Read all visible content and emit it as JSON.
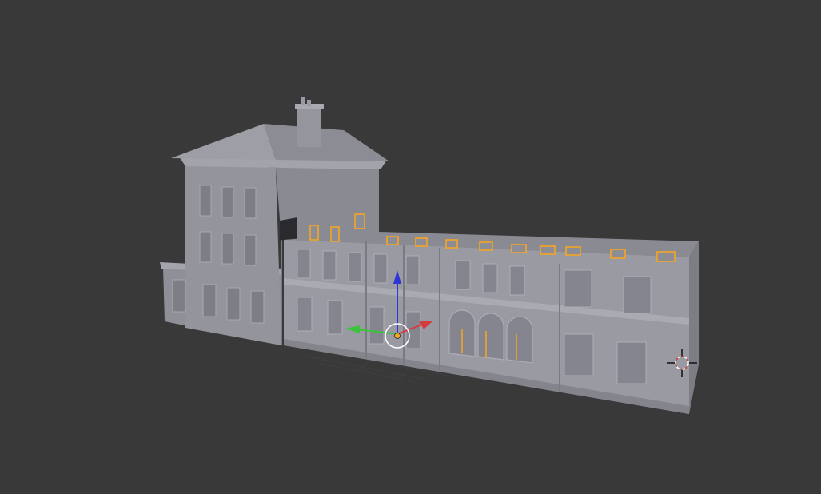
{
  "viewport": {
    "background": "#393939",
    "grid_color": "#4a4a4a",
    "model_color": "#909099",
    "model_shadow": "#76767f",
    "model_light": "#a6a6ae",
    "selection_color": "#f5a623"
  },
  "gizmo": {
    "x_axis_color": "#d23c3c",
    "y_axis_color": "#3cc33c",
    "z_axis_color": "#2e35d6"
  },
  "icons": {
    "transform_gizmo": "translate-manipulator-icon",
    "cursor": "3d-cursor-icon"
  }
}
